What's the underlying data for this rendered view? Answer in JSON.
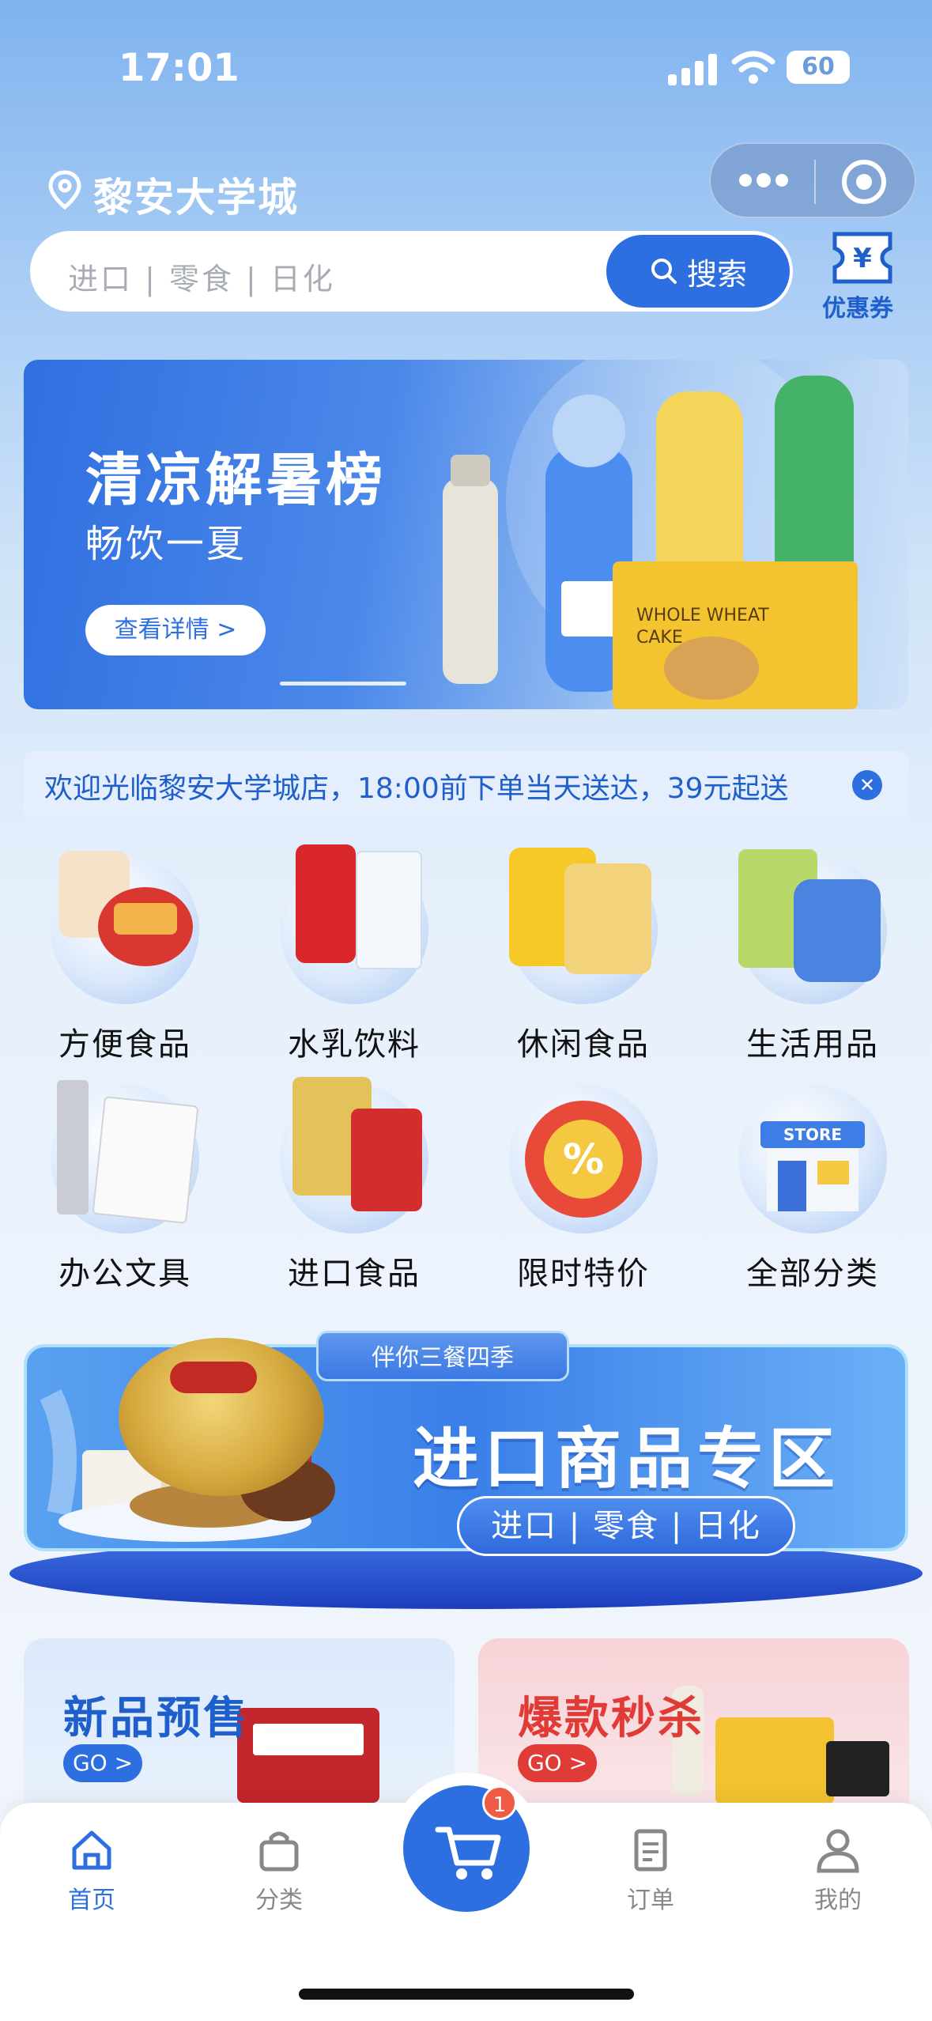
{
  "status_bar": {
    "time": "17:01",
    "battery": "60"
  },
  "header": {
    "location": "黎安大学城"
  },
  "search": {
    "placeholder": "进口 | 零食 | 日化",
    "button_label": "搜索"
  },
  "coupon": {
    "label": "优惠券"
  },
  "banner": {
    "title": "清凉解暑榜",
    "subtitle": "畅饮一夏",
    "button_label": "查看详情 >"
  },
  "notice": {
    "text": "欢迎光临黎安大学城店，18:00前下单当天送达，39元起送"
  },
  "categories": [
    {
      "label": "方便食品",
      "icon": "instant-food-icon"
    },
    {
      "label": "水乳饮料",
      "icon": "drinks-icon"
    },
    {
      "label": "休闲食品",
      "icon": "snacks-icon"
    },
    {
      "label": "生活用品",
      "icon": "daily-goods-icon"
    },
    {
      "label": "办公文具",
      "icon": "stationery-icon"
    },
    {
      "label": "进口食品",
      "icon": "imported-food-icon"
    },
    {
      "label": "限时特价",
      "icon": "discount-icon"
    },
    {
      "label": "全部分类",
      "icon": "store-icon"
    }
  ],
  "import_zone": {
    "tag": "伴你三餐四季",
    "title": "进口商品专区",
    "subtitle": "进口 | 零食 | 日化"
  },
  "promos": {
    "new": {
      "title": "新品预售",
      "go": "GO >"
    },
    "hot": {
      "title": "爆款秒杀",
      "go": "GO >"
    }
  },
  "tabbar": {
    "items": [
      {
        "label": "首页",
        "active": true
      },
      {
        "label": "分类",
        "active": false
      },
      {
        "label": "订单",
        "active": false
      },
      {
        "label": "我的",
        "active": false
      }
    ],
    "cart_badge": "1"
  },
  "colors": {
    "primary": "#2d6fe0",
    "accent_red": "#e03b36",
    "badge": "#ee5a43"
  }
}
